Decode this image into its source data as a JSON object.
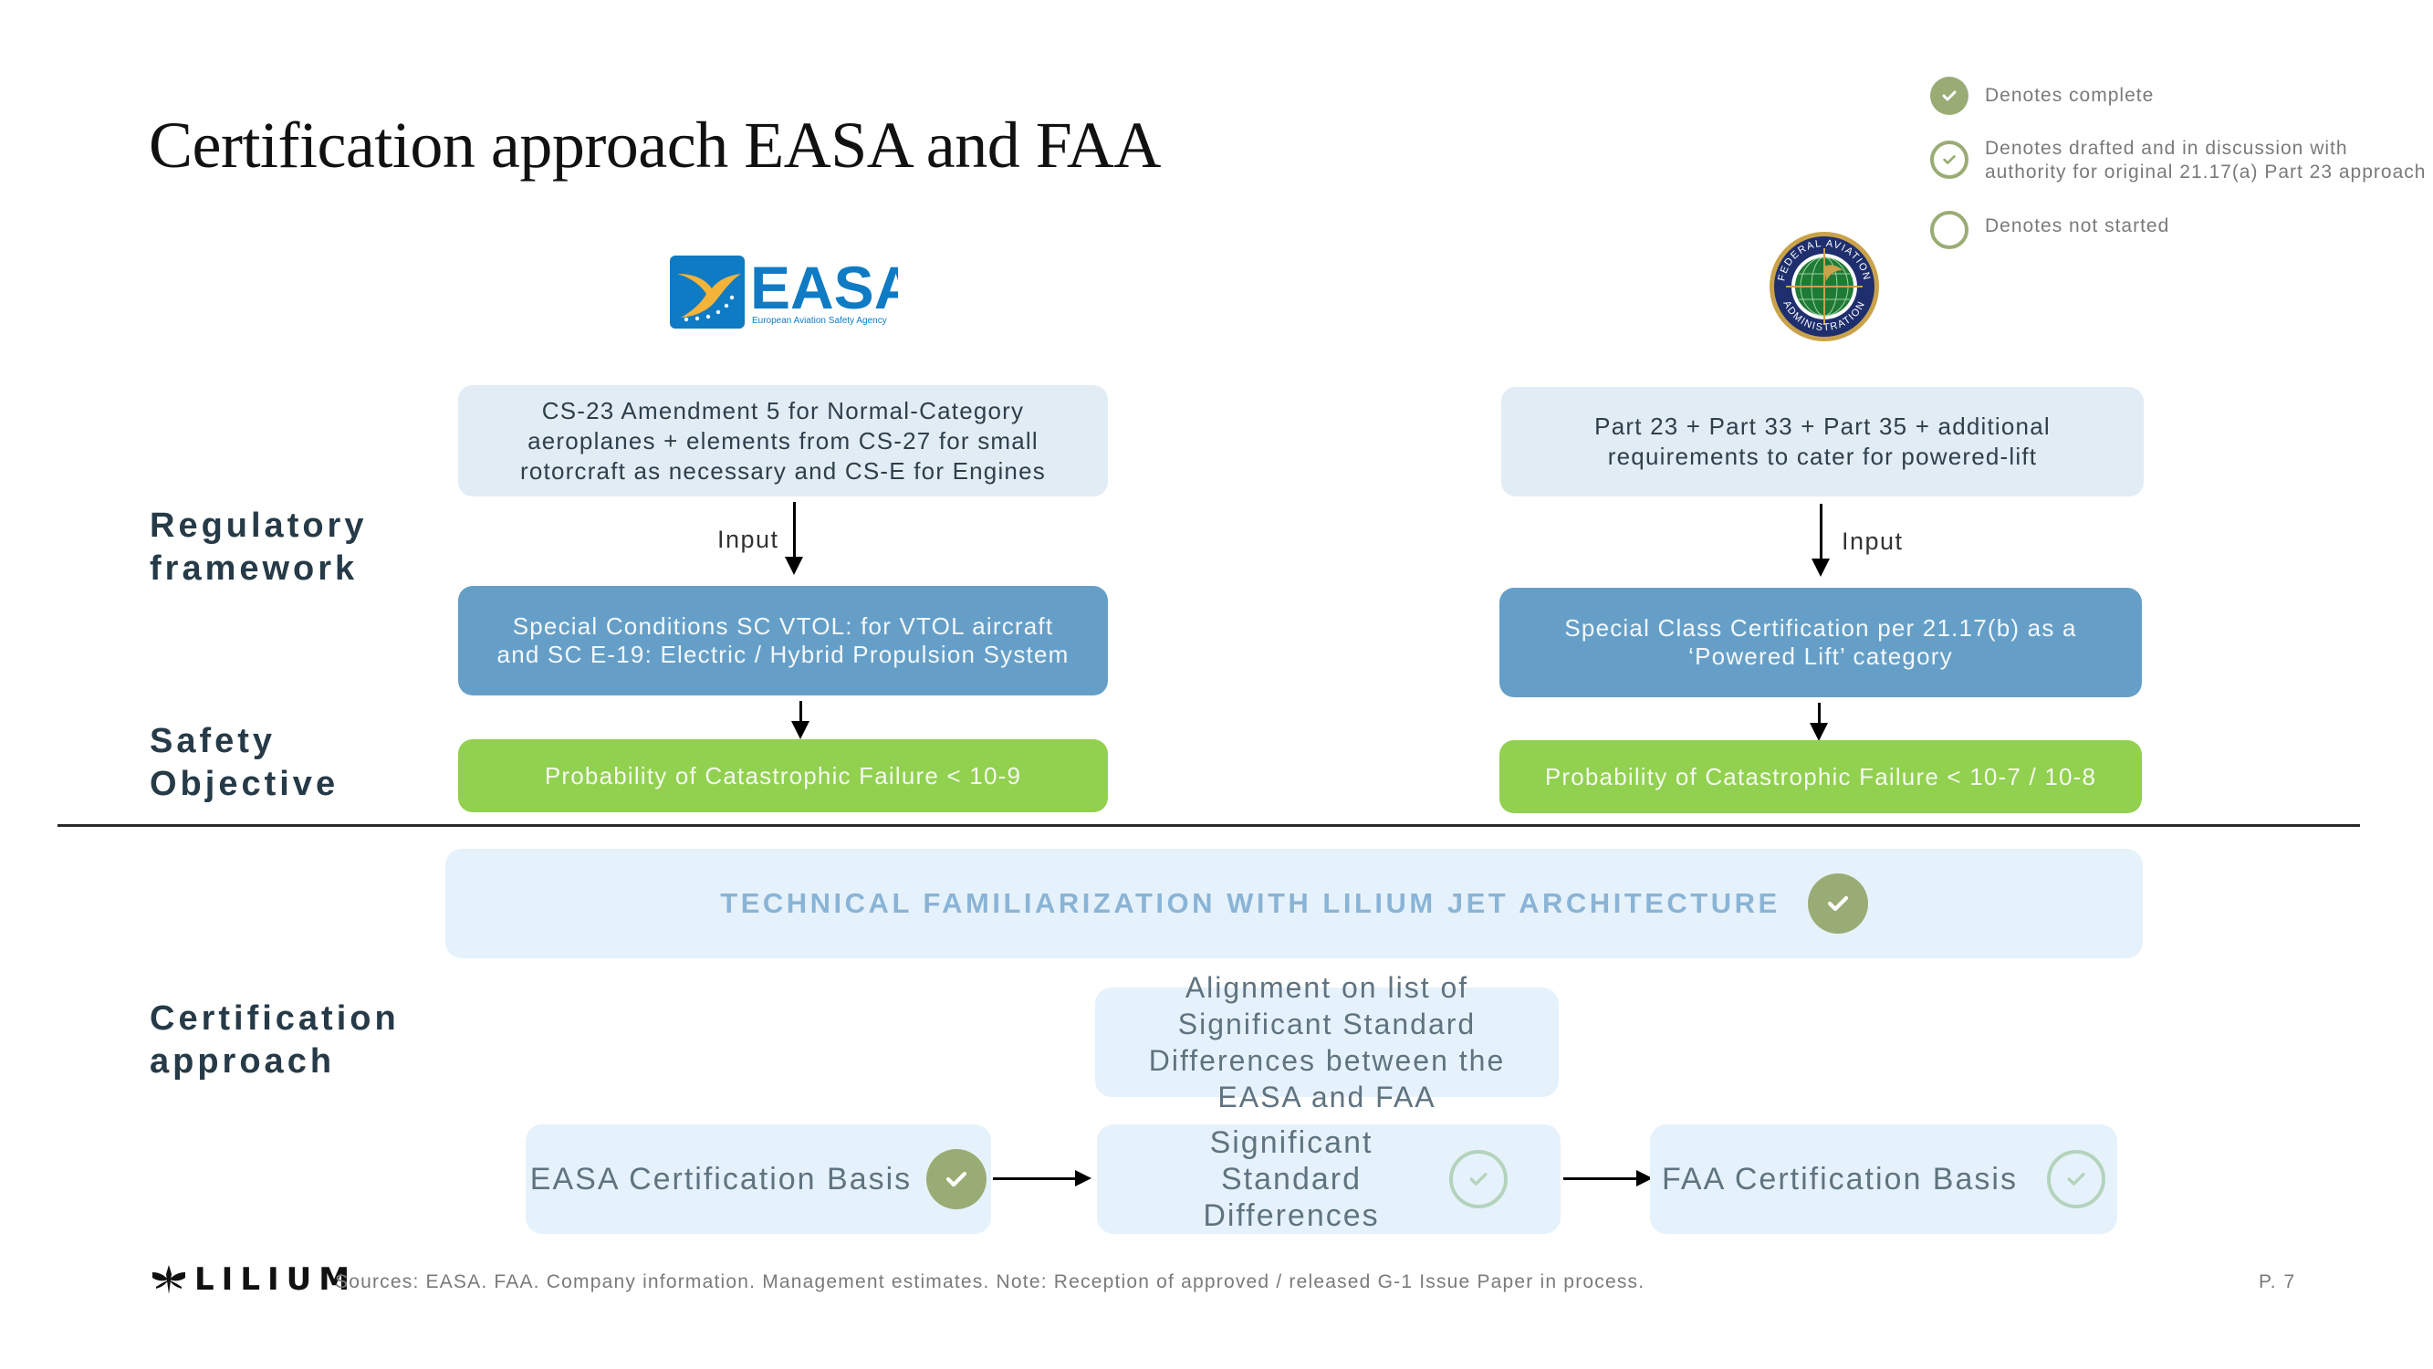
{
  "title": "Certification approach EASA and FAA",
  "legend": [
    {
      "icon": "check-filled-circle-icon",
      "status": "complete",
      "label": "Denotes complete"
    },
    {
      "icon": "check-outline-circle-icon",
      "status": "drafted",
      "label_line1": "Denotes drafted and in discussion with",
      "label_line2": "authority for original 21.17(a) Part 23 approach"
    },
    {
      "icon": "empty-circle-icon",
      "status": "not-started",
      "label": "Denotes not started"
    }
  ],
  "logos": {
    "easa": {
      "wordmark": "EASA",
      "tagline": "European Aviation Safety Agency"
    },
    "faa": {
      "top_text": "FEDERAL AVIATION",
      "bottom_text": "ADMINISTRATION"
    }
  },
  "section_labels": {
    "regulatory_line1": "Regulatory",
    "regulatory_line2": "framework",
    "safety_line1": "Safety",
    "safety_line2": "Objective",
    "certification_line1": "Certification",
    "certification_line2": "approach"
  },
  "easa_column": {
    "base": "CS-23 Amendment 5 for Normal-Category aeroplanes + elements from CS-27 for small rotorcraft as necessary and CS-E for Engines",
    "input_label": "Input",
    "special": "Special Conditions SC VTOL: for VTOL aircraft and SC E-19: Electric / Hybrid Propulsion System",
    "safety": "Probability of Catastrophic Failure < 10-9"
  },
  "faa_column": {
    "base": "Part 23 + Part 33 + Part 35 + additional requirements to cater for powered-lift",
    "input_label": "Input",
    "special": "Special Class Certification per 21.17(b) as a ‘Powered Lift’ category",
    "safety": "Probability of Catastrophic Failure < 10-7 / 10-8"
  },
  "band": {
    "label": "TECHNICAL FAMILIARIZATION WITH LILIUM JET ARCHITECTURE",
    "status": "complete"
  },
  "alignment": {
    "label": "Alignment on list of Significant Standard Differences between the EASA and FAA"
  },
  "flow": [
    {
      "label": "EASA Certification Basis",
      "status": "complete"
    },
    {
      "label": "Significant Standard Differences",
      "status": "drafted"
    },
    {
      "label": "FAA Certification Basis",
      "status": "drafted"
    }
  ],
  "footer": {
    "brand": "LILIUM",
    "sources": "Sources: EASA. FAA. Company information. Management estimates. Note: Reception of approved / released G-1 Issue Paper in process.",
    "page": "P. 7"
  },
  "colors": {
    "complete": "#9aac75",
    "drafted_outline": "#b4d3bd",
    "light_box": "#e1ecf5",
    "blue_box": "#659fc7",
    "green_box": "#92d050",
    "band": "#e6f2fb",
    "easa_blue": "#0e7bc4",
    "easa_yellow": "#f4b43a"
  }
}
